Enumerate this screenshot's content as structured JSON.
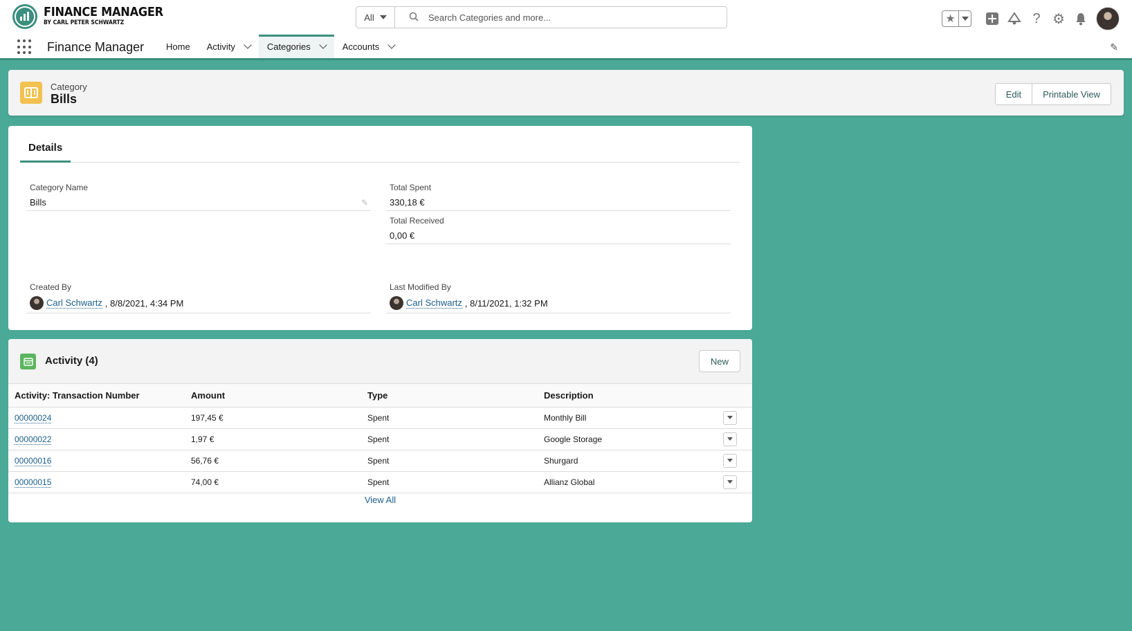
{
  "header": {
    "logo_title": "FINANCE MANAGER",
    "logo_subtitle": "BY CARL PETER SCHWARTZ",
    "search_scope": "All",
    "search_placeholder": "Search Categories and more..."
  },
  "nav": {
    "app_name": "Finance Manager",
    "items": [
      {
        "label": "Home",
        "has_menu": false,
        "active": false
      },
      {
        "label": "Activity",
        "has_menu": true,
        "active": false
      },
      {
        "label": "Categories",
        "has_menu": true,
        "active": true
      },
      {
        "label": "Accounts",
        "has_menu": true,
        "active": false
      }
    ]
  },
  "record": {
    "object_type": "Category",
    "name": "Bills",
    "actions": {
      "edit": "Edit",
      "printable_view": "Printable View"
    }
  },
  "details": {
    "tab_label": "Details",
    "category_name": {
      "label": "Category Name",
      "value": "Bills"
    },
    "total_spent": {
      "label": "Total Spent",
      "value": "330,18 €"
    },
    "total_received": {
      "label": "Total Received",
      "value": "0,00 €"
    },
    "created_by": {
      "label": "Created By",
      "user": "Carl Schwartz",
      "timestamp": ", 8/8/2021, 4:34 PM"
    },
    "last_modified_by": {
      "label": "Last Modified By",
      "user": "Carl Schwartz",
      "timestamp": ", 8/11/2021, 1:32 PM"
    }
  },
  "activity_list": {
    "title": "Activity (4)",
    "new_label": "New",
    "columns": [
      "Activity: Transaction Number",
      "Amount",
      "Type",
      "Description"
    ],
    "rows": [
      {
        "number": "00000024",
        "amount": "197,45 €",
        "type": "Spent",
        "description": "Monthly Bill"
      },
      {
        "number": "00000022",
        "amount": "1,97 €",
        "type": "Spent",
        "description": "Google Storage"
      },
      {
        "number": "00000016",
        "amount": "56,76 €",
        "type": "Spent",
        "description": "Shurgard"
      },
      {
        "number": "00000015",
        "amount": "74,00 €",
        "type": "Spent",
        "description": "Allianz Global"
      }
    ],
    "view_all": "View All"
  },
  "colors": {
    "background": "#4aa997",
    "brand": "#3b8f7e",
    "category_icon": "#f2c14f",
    "activity_icon": "#5bb55f",
    "link": "#1b5e8b"
  },
  "icons": [
    "app-logo-icon",
    "search-icon",
    "favorites-star-icon",
    "add-icon",
    "trailhead-icon",
    "help-icon",
    "setup-gear-icon",
    "notifications-bell-icon",
    "app-launcher-icon",
    "edit-nav-pencil-icon",
    "category-book-icon",
    "activity-list-icon"
  ]
}
